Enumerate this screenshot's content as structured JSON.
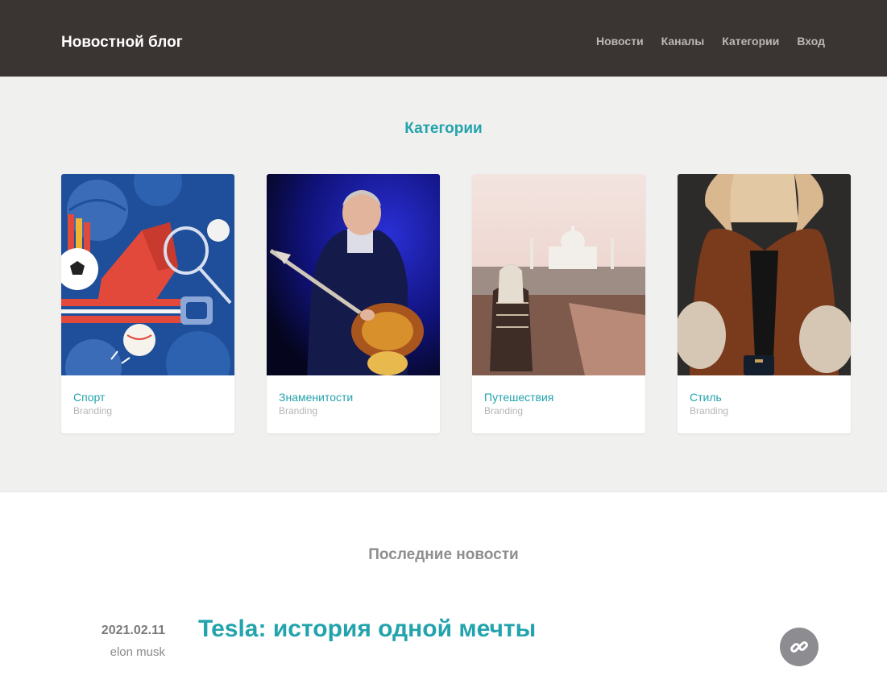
{
  "header": {
    "brand": "Новостной блог",
    "nav": [
      "Новости",
      "Каналы",
      "Категории",
      "Вход"
    ]
  },
  "categories": {
    "title": "Категории",
    "cards": [
      {
        "label": "Спорт",
        "sub": "Branding",
        "icon": "sports-image"
      },
      {
        "label": "Знаменитости",
        "sub": "Branding",
        "icon": "celebrity-image"
      },
      {
        "label": "Путешествия",
        "sub": "Branding",
        "icon": "travel-image"
      },
      {
        "label": "Стиль",
        "sub": "Branding",
        "icon": "style-image"
      }
    ]
  },
  "news": {
    "title": "Последние новости",
    "post": {
      "date": "2021.02.11",
      "author": "elon musk",
      "title_strong": "Tesla:",
      "title_rest": " история одной мечты"
    }
  },
  "colors": {
    "accent": "#23a3ad",
    "header_bg": "#3a3432",
    "section_bg": "#f0f0ef"
  }
}
